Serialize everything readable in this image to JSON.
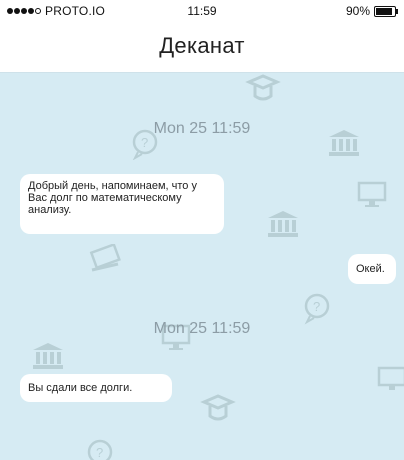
{
  "status_bar": {
    "carrier": "PROTO.IO",
    "time": "11:59",
    "battery": "90%",
    "battery_level": 0.9,
    "signal_bars": 4
  },
  "header": {
    "title": "Деканат"
  },
  "messages": [
    {
      "type": "timestamp",
      "text": "Mon 25 11:59"
    },
    {
      "type": "incoming",
      "text": "Добрый день, напоминаем, что у Вас долг по математическому анализу."
    },
    {
      "type": "outgoing",
      "text": "Окей."
    },
    {
      "type": "timestamp",
      "text": "Mon 25 11:59"
    },
    {
      "type": "incoming",
      "text": "Вы сдали все долги."
    }
  ],
  "colors": {
    "background": "#d6ebf3",
    "bubble": "#ffffff",
    "timestamp": "#8c9ca5"
  }
}
